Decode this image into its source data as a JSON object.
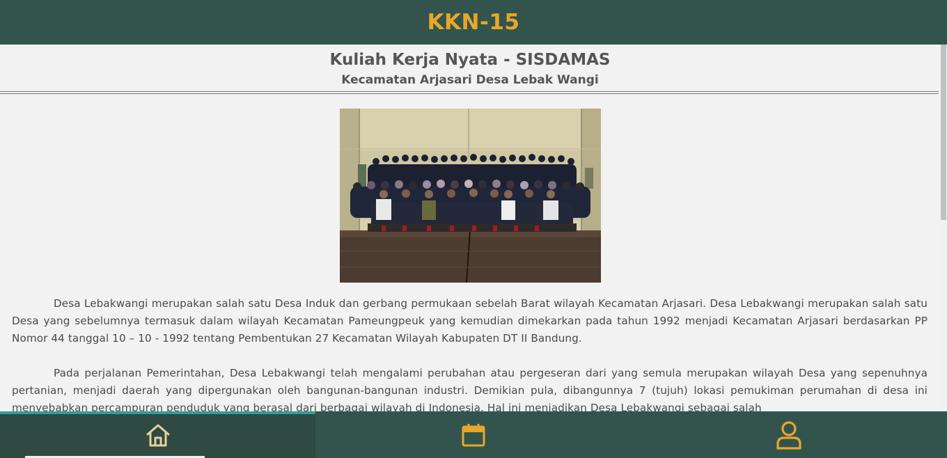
{
  "header": {
    "brand": "KKN-15"
  },
  "page": {
    "title": "Kuliah Kerja Nyata - SISDAMAS",
    "subtitle": "Kecamatan Arjasari Desa Lebak Wangi"
  },
  "article": {
    "paragraphs": [
      "Desa Lebakwangi merupakan salah satu Desa Induk dan gerbang permukaan sebelah Barat wilayah Kecamatan Arjasari. Desa Lebakwangi merupakan salah satu Desa yang sebelumnya termasuk dalam wilayah Kecamatan Pameungpeuk yang kemudian dimekarkan pada tahun 1992 menjadi Kecamatan Arjasari berdasarkan PP Nomor 44 tanggal 10 – 10 - 1992 tentang Pembentukan 27 Kecamatan Wilayah Kabupaten DT II Bandung.",
      "Pada perjalanan Pemerintahan, Desa Lebakwangi telah mengalami perubahan atau pergeseran dari yang semula merupakan wilayah Desa yang sepenuhnya pertanian, menjadi daerah yang dipergunakan oleh bangunan-bangunan industri. Demikian pula, dibangunnya 7 (tujuh) lokasi pemukiman perumahan di desa ini menyebabkan percampuran penduduk yang berasal dari berbagai wilayah di Indonesia. Hal ini menjadikan Desa Lebakwangi sebagai salah"
    ]
  },
  "nav": {
    "items": [
      {
        "icon": "home-icon",
        "active": true
      },
      {
        "icon": "calendar-icon",
        "active": false
      },
      {
        "icon": "user-icon",
        "active": false
      }
    ]
  },
  "colors": {
    "header_bg": "#33544c",
    "accent": "#e8a62a",
    "active_indicator": "#2aa198"
  }
}
